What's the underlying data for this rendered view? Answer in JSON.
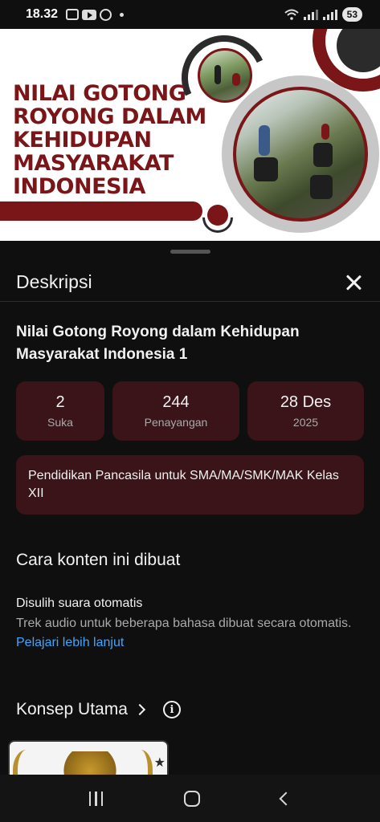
{
  "status_bar": {
    "time": "18.32",
    "battery": "53",
    "notification_icons": [
      "screenshot-icon",
      "youtube-icon",
      "whatsapp-icon",
      "dot-icon"
    ],
    "system_icons": [
      "wifi-icon",
      "signal-icon",
      "signal-icon",
      "battery-icon"
    ]
  },
  "thumbnail": {
    "title_line1": "NILAI GOTONG",
    "title_line2": "ROYONG DALAM",
    "title_line3": "KEHIDUPAN",
    "title_line4": "MASYARAKAT",
    "title_line5": "INDONESIA",
    "accent_color": "#7a1518",
    "secondary_color": "#2b2b2b"
  },
  "sheet": {
    "title": "Deskripsi",
    "close_icon": "close-icon",
    "video_title": "Nilai Gotong Royong dalam Kehidupan Masyarakat Indonesia 1",
    "stats": [
      {
        "value": "2",
        "label": "Suka"
      },
      {
        "value": "244",
        "label": "Penayangan"
      },
      {
        "value": "28 Des",
        "label": "2025"
      }
    ],
    "card_color": "#3a1418",
    "category": "Pendidikan Pancasila untuk SMA/MA/SMK/MAK Kelas XII",
    "how_made": {
      "heading": "Cara konten ini dibuat",
      "item_title": "Disulih suara otomatis",
      "item_desc": "Trek audio untuk beberapa bahasa dibuat secara otomatis.",
      "link": "Pelajari lebih lanjut",
      "link_color": "#3ea6ff"
    },
    "key_concepts": {
      "heading": "Konsep Utama"
    }
  },
  "navbar": {
    "recents_icon": "recents-icon",
    "home_icon": "home-icon",
    "back_icon": "back-icon"
  }
}
